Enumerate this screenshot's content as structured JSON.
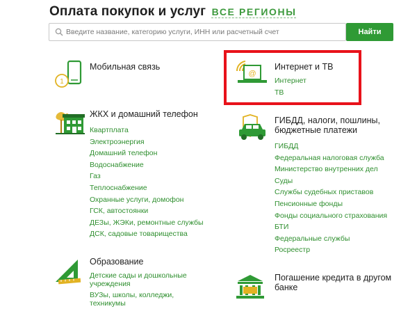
{
  "header": {
    "title": "Оплата покупок и услуг",
    "regions_link": "ВСЕ РЕГИОНЫ"
  },
  "search": {
    "placeholder": "Введите название, категорию услуги, ИНН или расчетный счет",
    "button_label": "Найти"
  },
  "categories": {
    "mobile": {
      "title": "Мобильная связь",
      "icon": "mobile-phone-icon"
    },
    "internet": {
      "title": "Интернет и ТВ",
      "icon": "laptop-wifi-icon",
      "links": [
        "Интернет",
        "ТВ"
      ]
    },
    "utilities": {
      "title": "ЖКХ и домашний телефон",
      "icon": "house-icon",
      "links": [
        "Квартплата",
        "Электроэнергия",
        "Домашний телефон",
        "Водоснабжение",
        "Газ",
        "Теплоснабжение",
        "Охранные услуги, домофон",
        "ГСК, автостоянки",
        "ДЕЗы, ЖЭКи, ремонтные службы",
        "ДСК, садовые товарищества"
      ]
    },
    "gibdd": {
      "title_line1": "ГИБДД, налоги, пошлины,",
      "title_line2": "бюджетные платежи",
      "icon": "car-shield-icon",
      "links": [
        "ГИБДД",
        "Федеральная налоговая служба",
        "Министерство внутренних дел",
        "Суды",
        "Службы судебных приставов",
        "Пенсионные фонды",
        "Фонды социального страхования",
        "БТИ",
        "Федеральные службы",
        "Росреестр"
      ]
    },
    "education": {
      "title": "Образование",
      "icon": "ruler-triangle-icon",
      "links": [
        "Детские сады и дошкольные учреждения",
        "ВУЗы, школы, колледжи, техникумы"
      ]
    },
    "credit": {
      "title_line1": "Погашение кредита в другом",
      "title_line2": "банке",
      "icon": "bank-building-icon"
    }
  },
  "colors": {
    "accent": "#2f9a35",
    "link": "#2f8f2f",
    "highlight": "#e8121a"
  }
}
